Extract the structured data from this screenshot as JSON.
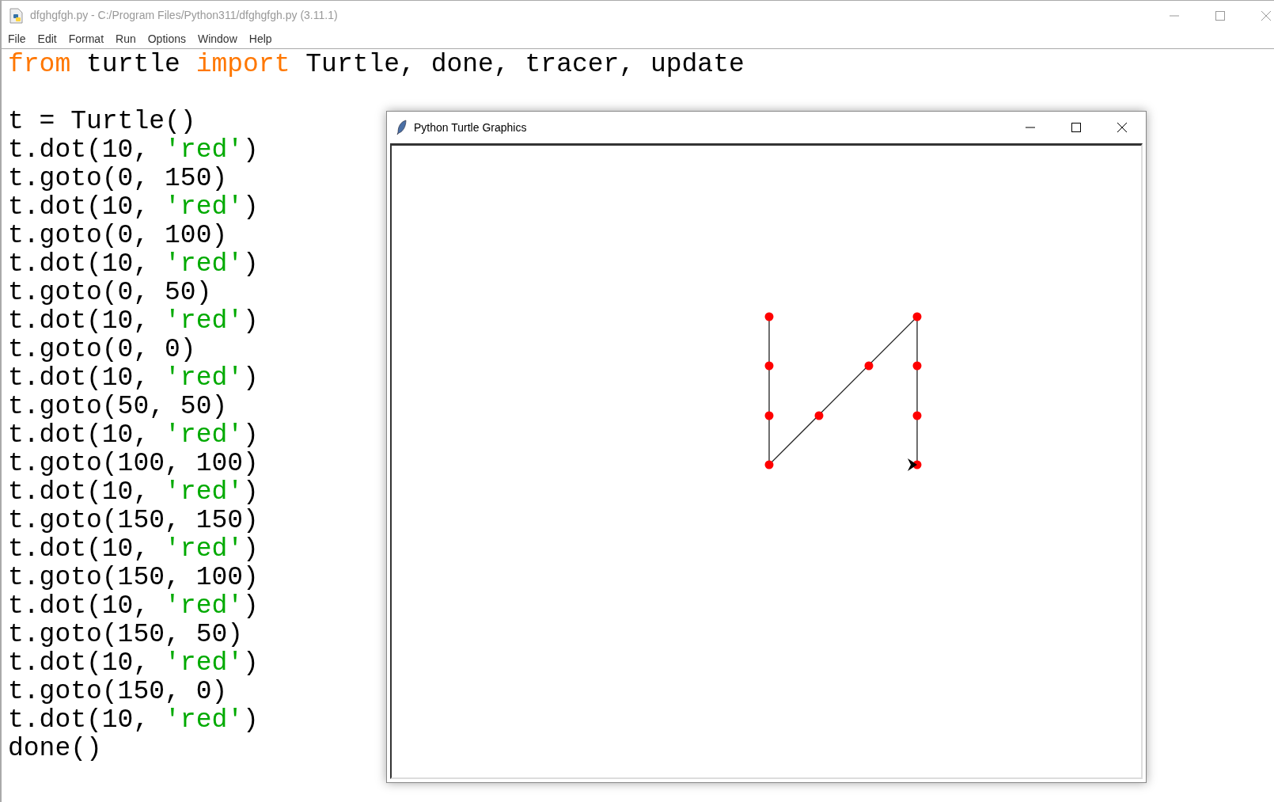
{
  "window": {
    "title": "dfghgfgh.py - C:/Program Files/Python311/dfghgfgh.py (3.11.1)"
  },
  "menu": [
    "File",
    "Edit",
    "Format",
    "Run",
    "Options",
    "Window",
    "Help"
  ],
  "code_blocks": [
    {
      "lines": [
        [
          {
            "kind": "keyword",
            "text": "from"
          },
          {
            "kind": "plain",
            "text": " turtle "
          },
          {
            "kind": "keyword",
            "text": "import"
          },
          {
            "kind": "plain",
            "text": " Turtle, done, tracer, update"
          }
        ]
      ]
    },
    {
      "lines": [
        [
          {
            "kind": "plain",
            "text": "t = Turtle()"
          }
        ],
        [
          {
            "kind": "plain",
            "text": "t.dot(10, "
          },
          {
            "kind": "string",
            "text": "'red'"
          },
          {
            "kind": "plain",
            "text": ")"
          }
        ],
        [
          {
            "kind": "plain",
            "text": "t.goto(0, 150)"
          }
        ],
        [
          {
            "kind": "plain",
            "text": "t.dot(10, "
          },
          {
            "kind": "string",
            "text": "'red'"
          },
          {
            "kind": "plain",
            "text": ")"
          }
        ],
        [
          {
            "kind": "plain",
            "text": "t.goto(0, 100)"
          }
        ],
        [
          {
            "kind": "plain",
            "text": "t.dot(10, "
          },
          {
            "kind": "string",
            "text": "'red'"
          },
          {
            "kind": "plain",
            "text": ")"
          }
        ],
        [
          {
            "kind": "plain",
            "text": "t.goto(0, 50)"
          }
        ],
        [
          {
            "kind": "plain",
            "text": "t.dot(10, "
          },
          {
            "kind": "string",
            "text": "'red'"
          },
          {
            "kind": "plain",
            "text": ")"
          }
        ],
        [
          {
            "kind": "plain",
            "text": "t.goto(0, 0)"
          }
        ],
        [
          {
            "kind": "plain",
            "text": "t.dot(10, "
          },
          {
            "kind": "string",
            "text": "'red'"
          },
          {
            "kind": "plain",
            "text": ")"
          }
        ],
        [
          {
            "kind": "plain",
            "text": "t.goto(50, 50)"
          }
        ],
        [
          {
            "kind": "plain",
            "text": "t.dot(10, "
          },
          {
            "kind": "string",
            "text": "'red'"
          },
          {
            "kind": "plain",
            "text": ")"
          }
        ],
        [
          {
            "kind": "plain",
            "text": "t.goto(100, 100)"
          }
        ],
        [
          {
            "kind": "plain",
            "text": "t.dot(10, "
          },
          {
            "kind": "string",
            "text": "'red'"
          },
          {
            "kind": "plain",
            "text": ")"
          }
        ],
        [
          {
            "kind": "plain",
            "text": "t.goto(150, 150)"
          }
        ],
        [
          {
            "kind": "plain",
            "text": "t.dot(10, "
          },
          {
            "kind": "string",
            "text": "'red'"
          },
          {
            "kind": "plain",
            "text": ")"
          }
        ],
        [
          {
            "kind": "plain",
            "text": "t.goto(150, 100)"
          }
        ],
        [
          {
            "kind": "plain",
            "text": "t.dot(10, "
          },
          {
            "kind": "string",
            "text": "'red'"
          },
          {
            "kind": "plain",
            "text": ")"
          }
        ],
        [
          {
            "kind": "plain",
            "text": "t.goto(150, 50)"
          }
        ],
        [
          {
            "kind": "plain",
            "text": "t.dot(10, "
          },
          {
            "kind": "string",
            "text": "'red'"
          },
          {
            "kind": "plain",
            "text": ")"
          }
        ],
        [
          {
            "kind": "plain",
            "text": "t.goto(150, 0)"
          }
        ],
        [
          {
            "kind": "plain",
            "text": "t.dot(10, "
          },
          {
            "kind": "string",
            "text": "'red'"
          },
          {
            "kind": "plain",
            "text": ")"
          }
        ],
        [
          {
            "kind": "plain",
            "text": "done()"
          }
        ]
      ]
    }
  ],
  "turtle_window": {
    "title": "Python Turtle Graphics"
  }
}
